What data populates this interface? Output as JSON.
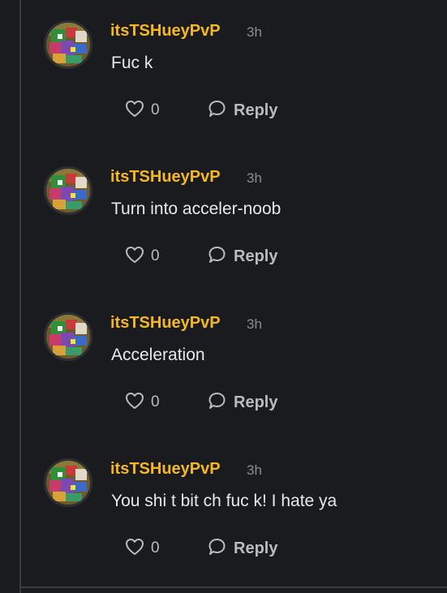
{
  "comments": [
    {
      "username": "itsTSHueyPvP",
      "time": "3h",
      "text": "Fuc k",
      "likes": "0",
      "reply_label": "Reply"
    },
    {
      "username": "itsTSHueyPvP",
      "time": "3h",
      "text": "Turn into acceler-noob",
      "likes": "0",
      "reply_label": "Reply"
    },
    {
      "username": "itsTSHueyPvP",
      "time": "3h",
      "text": "Acceleration",
      "likes": "0",
      "reply_label": "Reply"
    },
    {
      "username": "itsTSHueyPvP",
      "time": "3h",
      "text": "You shi t bit ch fuc k! I hate ya",
      "likes": "0",
      "reply_label": "Reply"
    }
  ],
  "icons": {
    "like": "heart-icon",
    "reply": "speech-bubble-icon"
  },
  "colors": {
    "background": "#1a1b1e",
    "username": "#f5b824",
    "body_text": "#e8e8ea",
    "meta": "#8b8d93",
    "actions": "#b9bbc0"
  }
}
